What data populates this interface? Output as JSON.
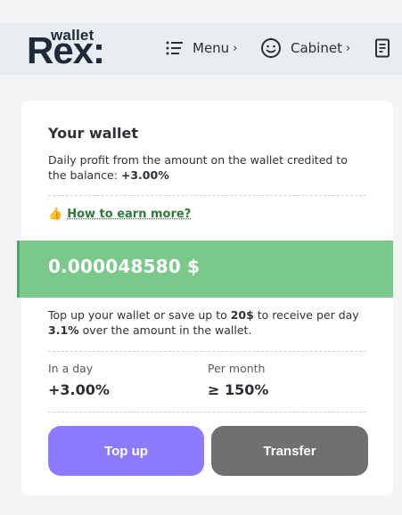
{
  "header": {
    "logo": {
      "top": "wallet",
      "main": "Rex:"
    },
    "menu_label": "Menu",
    "menu_icon": "list-icon",
    "cabinet_label": "Cabinet",
    "cabinet_icon": "smile-face-icon",
    "chevron": "›",
    "doc_icon": "document-icon"
  },
  "card": {
    "title": "Your wallet",
    "description": "Daily profit from the amount on the wallet credited to the balance: ",
    "description_rate": "+3.00%",
    "earn_emoji": "👍",
    "earn_link": "How to earn more?",
    "balance": "0.000048580 $",
    "topup_info_prefix": "Top up your wallet or save up to ",
    "topup_info_amount": "20$",
    "topup_info_middle": " to receive per day ",
    "topup_info_rate": "3.1%",
    "topup_info_suffix": " over the amount in the wallet.",
    "stats": {
      "day_label": "In a day",
      "day_value": "+3.00%",
      "month_label": "Per month",
      "month_value": "≥ 150%"
    },
    "buttons": {
      "top_up": "Top up",
      "transfer": "Transfer"
    }
  },
  "colors": {
    "accent_green": "#7bc98a",
    "link_green": "#2f7a3a",
    "topup_purple": "#8c7aff",
    "transfer_gray": "#707070"
  }
}
